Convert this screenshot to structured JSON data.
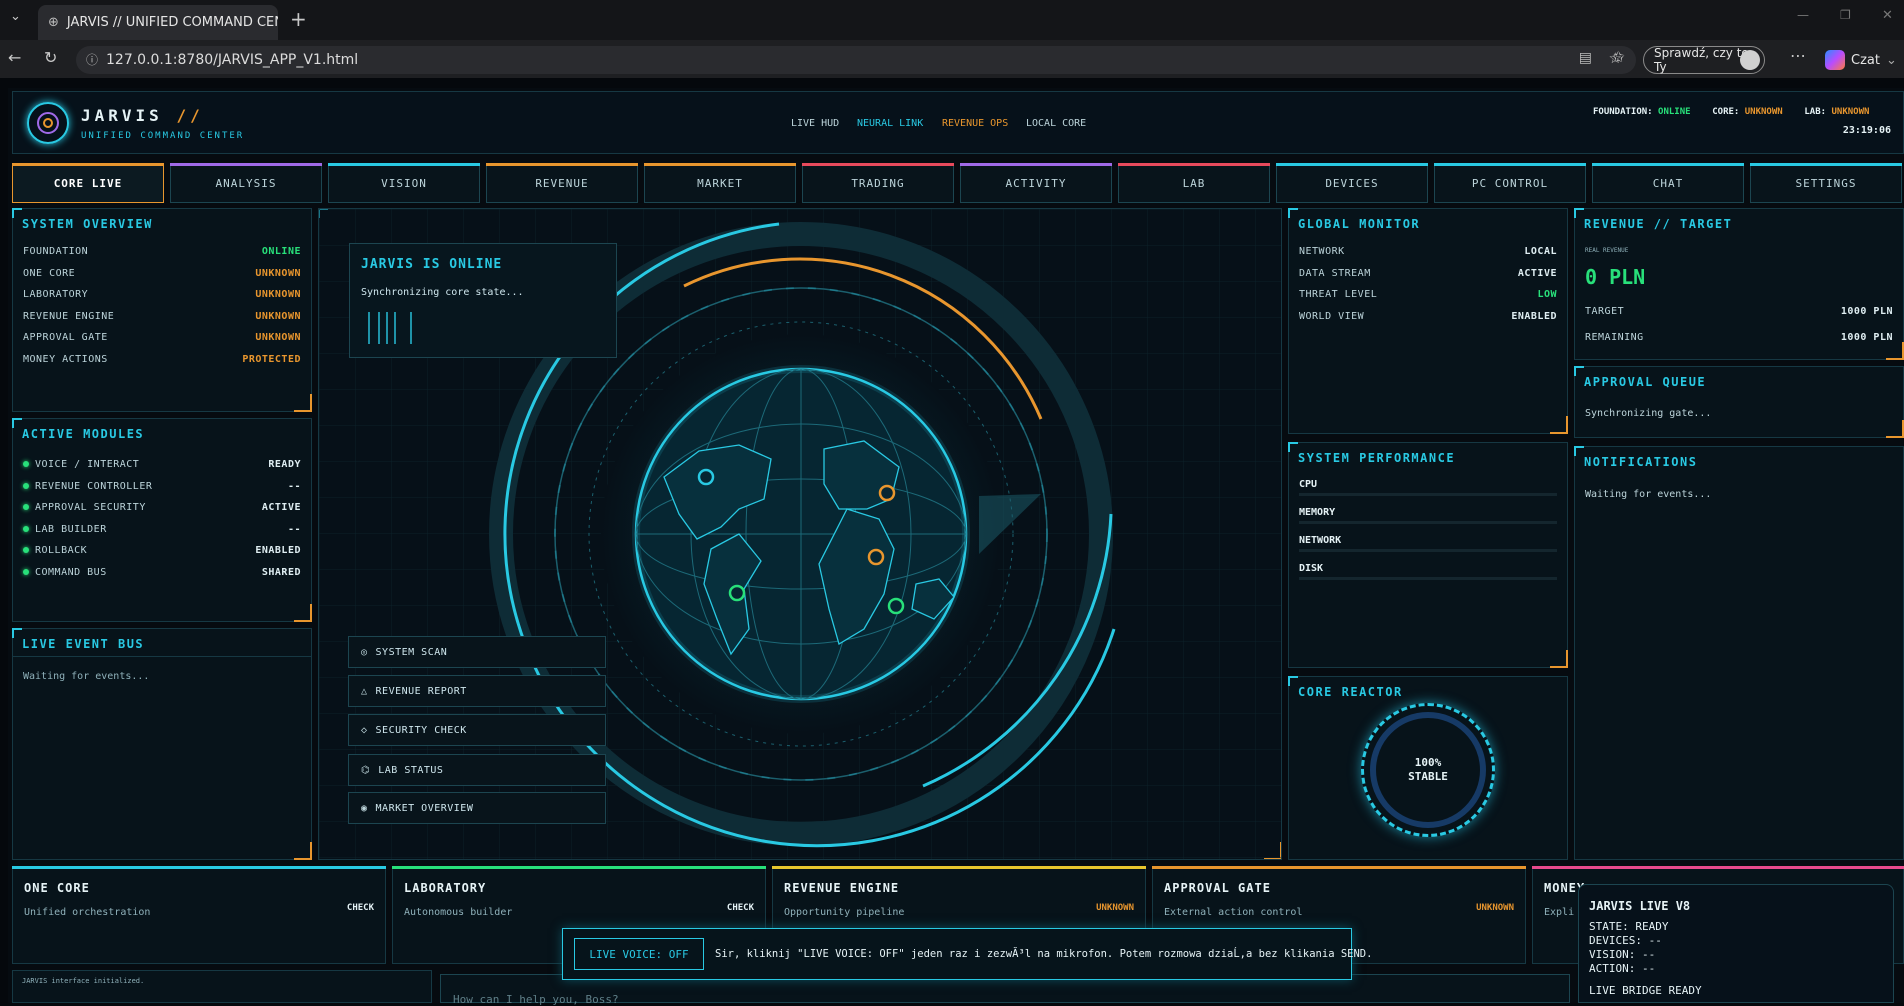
{
  "browser": {
    "tab_title": "JARVIS // UNIFIED COMMAND CEN",
    "url": "127.0.0.1:8780/JARVIS_APP_V1.html",
    "check_label": "Sprawdź, czy to Ty",
    "copilot_label": "Czat"
  },
  "header": {
    "brand": "JARVIS",
    "brand_slash": "//",
    "subtitle": "UNIFIED COMMAND CENTER",
    "nav": [
      "LIVE HUD",
      "NEURAL LINK",
      "REVENUE OPS",
      "LOCAL CORE"
    ],
    "status": {
      "foundation_label": "FOUNDATION:",
      "foundation_value": "ONLINE",
      "core_label": "CORE:",
      "core_value": "UNKNOWN",
      "lab_label": "LAB:",
      "lab_value": "UNKNOWN"
    },
    "time": "23:19:06"
  },
  "tabs": [
    {
      "label": "CORE LIVE",
      "color": "#e8962e",
      "active": true
    },
    {
      "label": "ANALYSIS",
      "color": "#a06ae8"
    },
    {
      "label": "VISION",
      "color": "#29c9e3"
    },
    {
      "label": "REVENUE",
      "color": "#e8962e"
    },
    {
      "label": "MARKET",
      "color": "#e8962e"
    },
    {
      "label": "TRADING",
      "color": "#e84a5c"
    },
    {
      "label": "ACTIVITY",
      "color": "#a06ae8"
    },
    {
      "label": "LAB",
      "color": "#e84a5c"
    },
    {
      "label": "DEVICES",
      "color": "#29c9e3"
    },
    {
      "label": "PC CONTROL",
      "color": "#29c9e3"
    },
    {
      "label": "CHAT",
      "color": "#29c9e3"
    },
    {
      "label": "SETTINGS",
      "color": "#29c9e3"
    }
  ],
  "system_overview": {
    "title": "SYSTEM OVERVIEW",
    "rows": [
      {
        "label": "FOUNDATION",
        "value": "ONLINE",
        "kind": "on"
      },
      {
        "label": "ONE CORE",
        "value": "UNKNOWN",
        "kind": "unk"
      },
      {
        "label": "LABORATORY",
        "value": "UNKNOWN",
        "kind": "unk"
      },
      {
        "label": "REVENUE ENGINE",
        "value": "UNKNOWN",
        "kind": "unk"
      },
      {
        "label": "APPROVAL GATE",
        "value": "UNKNOWN",
        "kind": "unk"
      },
      {
        "label": "MONEY ACTIONS",
        "value": "PROTECTED",
        "kind": "unk"
      }
    ]
  },
  "active_modules": {
    "title": "ACTIVE MODULES",
    "rows": [
      {
        "label": "VOICE / INTERACT",
        "value": "READY"
      },
      {
        "label": "REVENUE CONTROLLER",
        "value": "--"
      },
      {
        "label": "APPROVAL SECURITY",
        "value": "ACTIVE"
      },
      {
        "label": "LAB BUILDER",
        "value": "--"
      },
      {
        "label": "ROLLBACK",
        "value": "ENABLED"
      },
      {
        "label": "COMMAND BUS",
        "value": "SHARED"
      }
    ]
  },
  "event_bus": {
    "title": "LIVE EVENT BUS",
    "text": "Waiting for events..."
  },
  "center": {
    "status_title": "JARVIS IS ONLINE",
    "status_sub": "Synchronizing core state...",
    "actions": [
      {
        "label": "SYSTEM SCAN",
        "icon": "◎"
      },
      {
        "label": "REVENUE REPORT",
        "icon": "△"
      },
      {
        "label": "SECURITY CHECK",
        "icon": "◇"
      },
      {
        "label": "LAB STATUS",
        "icon": "⌬"
      },
      {
        "label": "MARKET OVERVIEW",
        "icon": "◉"
      }
    ]
  },
  "global_monitor": {
    "title": "GLOBAL MONITOR",
    "rows": [
      {
        "label": "NETWORK",
        "value": "LOCAL",
        "kind": "plain"
      },
      {
        "label": "DATA STREAM",
        "value": "ACTIVE",
        "kind": "plain"
      },
      {
        "label": "THREAT LEVEL",
        "value": "LOW",
        "kind": "on"
      },
      {
        "label": "WORLD VIEW",
        "value": "ENABLED",
        "kind": "plain"
      }
    ]
  },
  "performance": {
    "title": "SYSTEM PERFORMANCE",
    "items": [
      "CPU",
      "MEMORY",
      "NETWORK",
      "DISK"
    ]
  },
  "reactor": {
    "title": "CORE REACTOR",
    "value": "100%",
    "state": "STABLE"
  },
  "revenue": {
    "title": "REVENUE // TARGET",
    "caption": "REAL REVENUE",
    "amount": "0 PLN",
    "target_label": "TARGET",
    "target_value": "1000 PLN",
    "remaining_label": "REMAINING",
    "remaining_value": "1000 PLN"
  },
  "approval": {
    "title": "APPROVAL QUEUE",
    "text": "Synchronizing gate..."
  },
  "notifications": {
    "title": "NOTIFICATIONS",
    "text": "Waiting for events..."
  },
  "bottom_cards": [
    {
      "title": "ONE CORE",
      "sub": "Unified orchestration",
      "action": "CHECK",
      "color": "#29c9e3",
      "action_color": "#e6f3f6"
    },
    {
      "title": "LABORATORY",
      "sub": "Autonomous builder",
      "action": "CHECK",
      "color": "#28e07a",
      "action_color": "#e6f3f6"
    },
    {
      "title": "REVENUE ENGINE",
      "sub": "Opportunity pipeline",
      "action": "UNKNOWN",
      "color": "#e8c62e",
      "action_color": "#e8962e"
    },
    {
      "title": "APPROVAL GATE",
      "sub": "External action control",
      "action": "UNKNOWN",
      "color": "#e8962e",
      "action_color": "#e8962e"
    },
    {
      "title": "MONEY",
      "sub": "Expli",
      "action": "",
      "color": "#e84a8c",
      "action_color": "#e8962e"
    }
  ],
  "voice": {
    "button": "LIVE VOICE: OFF",
    "message": "Sir, kliknij \"LIVE VOICE: OFF\" jeden raz i zezwĂ³l na mikrofon. Potem rozmowa dziaĹ‚a bez klikania SEND."
  },
  "live_panel": {
    "title": "JARVIS LIVE V8",
    "state": "STATE: READY",
    "devices": "DEVICES: --",
    "vision": "VISION: --",
    "action": "ACTION: --",
    "bridge": "LIVE BRIDGE READY"
  },
  "log": {
    "text": "JARVIS interface initialized."
  },
  "chat": {
    "placeholder": "How can I help you, Boss?"
  }
}
